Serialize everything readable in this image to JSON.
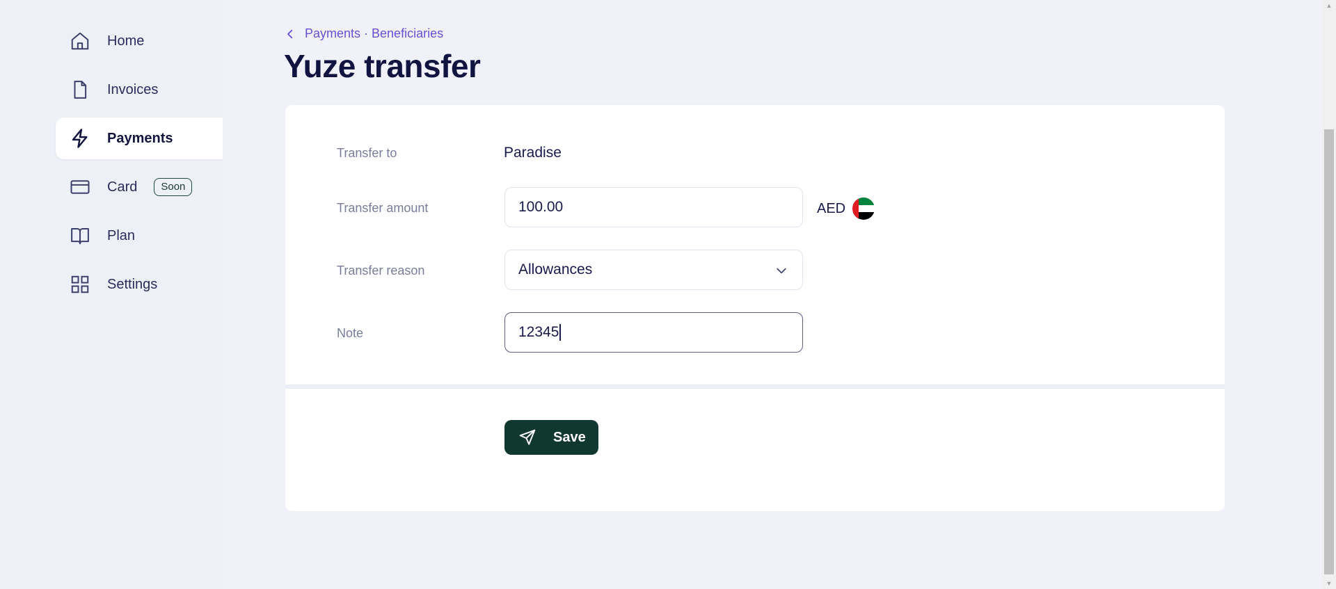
{
  "sidebar": {
    "items": [
      {
        "label": "Home",
        "icon": "home-icon"
      },
      {
        "label": "Invoices",
        "icon": "file-icon"
      },
      {
        "label": "Payments",
        "icon": "lightning-icon",
        "active": true
      },
      {
        "label": "Card",
        "icon": "card-icon",
        "badge": "Soon"
      },
      {
        "label": "Plan",
        "icon": "book-icon"
      },
      {
        "label": "Settings",
        "icon": "grid-icon"
      }
    ]
  },
  "breadcrumb": {
    "text": "Payments · Beneficiaries"
  },
  "page": {
    "title": "Yuze transfer"
  },
  "form": {
    "transfer_to": {
      "label": "Transfer to",
      "value": "Paradise"
    },
    "amount": {
      "label": "Transfer amount",
      "value": "100.00",
      "currency": "AED"
    },
    "reason": {
      "label": "Transfer reason",
      "value": "Allowances"
    },
    "note": {
      "label": "Note",
      "value": "12345"
    }
  },
  "actions": {
    "save_label": "Save"
  },
  "colors": {
    "accent": "#6a4fd6",
    "primary_button": "#11382f",
    "background": "#f0f1f9"
  }
}
